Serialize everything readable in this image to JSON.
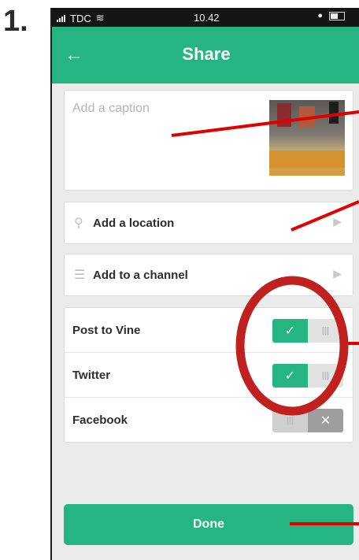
{
  "step": {
    "number": "1."
  },
  "status_bar": {
    "carrier": "TDC",
    "time": "10.42"
  },
  "header": {
    "title": "Share",
    "back_icon": "arrow-left-icon"
  },
  "caption": {
    "placeholder": "Add a caption"
  },
  "location": {
    "label": "Add a location",
    "icon": "location-pin-icon"
  },
  "channel": {
    "label": "Add to a channel",
    "icon": "list-icon"
  },
  "toggles": [
    {
      "label": "Post to Vine",
      "on": true
    },
    {
      "label": "Twitter",
      "on": true
    },
    {
      "label": "Facebook",
      "on": false
    }
  ],
  "done": {
    "label": "Done"
  },
  "colors": {
    "accent": "#25b583",
    "annotation": "#e00000",
    "highlight_circle": "#c0201e"
  }
}
